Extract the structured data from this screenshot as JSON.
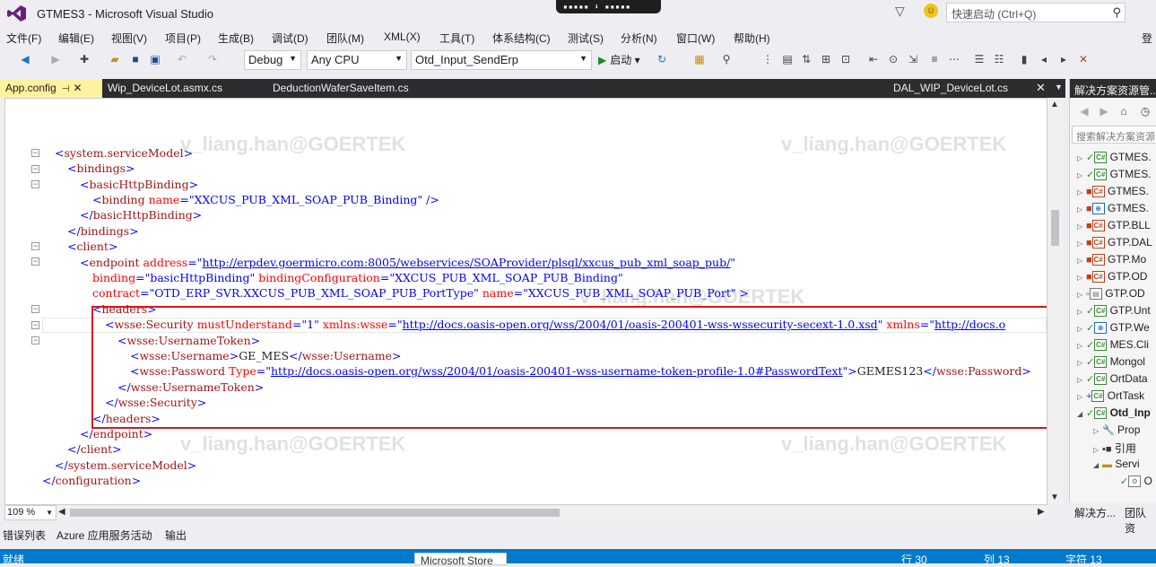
{
  "window": {
    "title": "GTMES3 - Microsoft Visual Studio",
    "quick_launch_placeholder": "快速启动 (Ctrl+Q)",
    "login": "登"
  },
  "menu": [
    "文件(F)",
    "编辑(E)",
    "视图(V)",
    "项目(P)",
    "生成(B)",
    "调试(D)",
    "团队(M)",
    "XML(X)",
    "工具(T)",
    "体系结构(C)",
    "测试(S)",
    "分析(N)",
    "窗口(W)",
    "帮助(H)"
  ],
  "toolbar": {
    "config": "Debug",
    "platform": "Any CPU",
    "startup_project": "Otd_Input_SendErp",
    "start_label": "启动"
  },
  "tabs": {
    "active": "App.config",
    "others": [
      "Wip_DeviceLot.asmx.cs",
      "DeductionWaferSaveItem.cs"
    ],
    "right": "DAL_WIP_DeviceLot.cs"
  },
  "code": {
    "l1_tag": "system.serviceModel",
    "l2_tag": "bindings",
    "l3_tag": "basicHttpBinding",
    "l4_tag": "binding",
    "l4_attr": "name",
    "l4_val": "XXCUS_PUB_XML_SOAP_PUB_Binding",
    "l5_tag": "basicHttpBinding",
    "l6_tag": "bindings",
    "l7_tag": "client",
    "l8_tag": "endpoint",
    "l8_attr": "address",
    "l8_url": "http://erpdev.goermicro.com:8005/webservices/SOAProvider/plsql/xxcus_pub_xml_soap_pub/",
    "l9_attr1": "binding",
    "l9_val1": "basicHttpBinding",
    "l9_attr2": "bindingConfiguration",
    "l9_val2": "XXCUS_PUB_XML_SOAP_PUB_Binding",
    "l10_attr1": "contract",
    "l10_val1": "OTD_ERP_SVR.XXCUS_PUB_XML_SOAP_PUB_PortType",
    "l10_attr2": "name",
    "l10_val2": "XXCUS_PUB_XML_SOAP_PUB_Port",
    "l11_tag": "headers",
    "l12_tag": "wsse:Security",
    "l12_attr1": "mustUnderstand",
    "l12_val1": "1",
    "l12_attr2": "xmlns:wsse",
    "l12_url": "http://docs.oasis-open.org/wss/2004/01/oasis-200401-wss-wssecurity-secext-1.0.xsd",
    "l12_attr3": "xmlns",
    "l12_url2": "http://docs.o",
    "l13_tag": "wsse:UsernameToken",
    "l14_tag": "wsse:Username",
    "l14_text": "GE_MES",
    "l15_tag": "wsse:Password",
    "l15_attr": "Type",
    "l15_url": "http://docs.oasis-open.org/wss/2004/01/oasis-200401-wss-username-token-profile-1.0#PasswordText",
    "l15_text": "GEMES123",
    "l16_tag": "wsse:UsernameToken",
    "l17_tag": "wsse:Security",
    "l18_tag": "headers",
    "l19_tag": "endpoint",
    "l20_tag": "client",
    "l21_tag": "system.serviceModel",
    "l22_tag": "configuration"
  },
  "watermark": "v_liang.han@GOERTEK",
  "zoom": "109 %",
  "bottom_tabs": [
    "错误列表",
    "Azure 应用服务活动",
    "输出"
  ],
  "status": {
    "ready": "就绪",
    "row": "行 30",
    "col": "列 13",
    "char": "字符 13",
    "store": "Microsoft Store"
  },
  "solution": {
    "title": "解决方案资源管...",
    "search_placeholder": "搜索解决方案资源",
    "items": [
      "GTMES.",
      "GTMES.",
      "GTMES.",
      "GTMES.",
      "GTP.BLL",
      "GTP.DAL",
      "GTP.Mo",
      "GTP.OD",
      "GTP.OD",
      "GTP.Unt",
      "GTP.We",
      "MES.Cli",
      "Mongol",
      "OrtData",
      "OrtTask",
      "Otd_Inp",
      "Prop",
      "引用",
      "Servi",
      "O"
    ],
    "bottom_tabs": [
      "解决方...",
      "团队资"
    ]
  }
}
